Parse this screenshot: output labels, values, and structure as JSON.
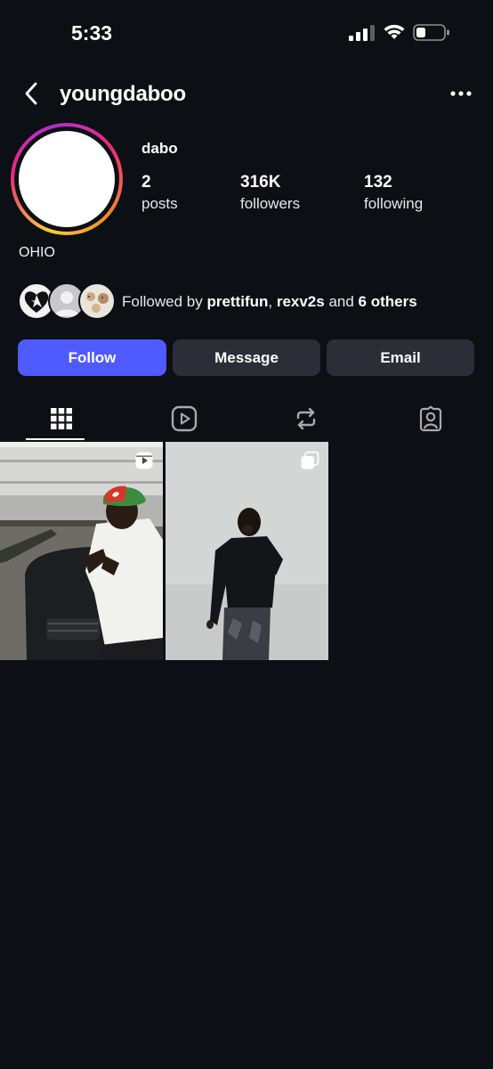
{
  "status_bar": {
    "time": "5:33"
  },
  "header": {
    "username": "youngdaboo"
  },
  "profile": {
    "display_name": "dabo",
    "stats": {
      "posts": {
        "value": "2",
        "label": "posts"
      },
      "followers": {
        "value": "316K",
        "label": "followers"
      },
      "following": {
        "value": "132",
        "label": "following"
      }
    },
    "bio": "OHIO"
  },
  "followed_by": {
    "prefix": "Followed by ",
    "user1": "prettifun",
    "sep": ", ",
    "user2": "rexv2s",
    "and": " and ",
    "others": "6 others"
  },
  "actions": {
    "follow_label": "Follow",
    "message_label": "Message",
    "email_label": "Email"
  },
  "tabs": [
    {
      "icon": "grid-icon",
      "selected": true
    },
    {
      "icon": "reels-icon",
      "selected": false
    },
    {
      "icon": "reposts-icon",
      "selected": false
    },
    {
      "icon": "tagged-icon",
      "selected": false
    }
  ],
  "posts": [
    {
      "type": "reel",
      "badge_icon": "reel-badge-icon"
    },
    {
      "type": "carousel",
      "badge_icon": "carousel-badge-icon"
    }
  ],
  "colors": {
    "background": "#0c0f14",
    "follow_button": "#4f5bff",
    "secondary_button": "#2b2e36"
  }
}
